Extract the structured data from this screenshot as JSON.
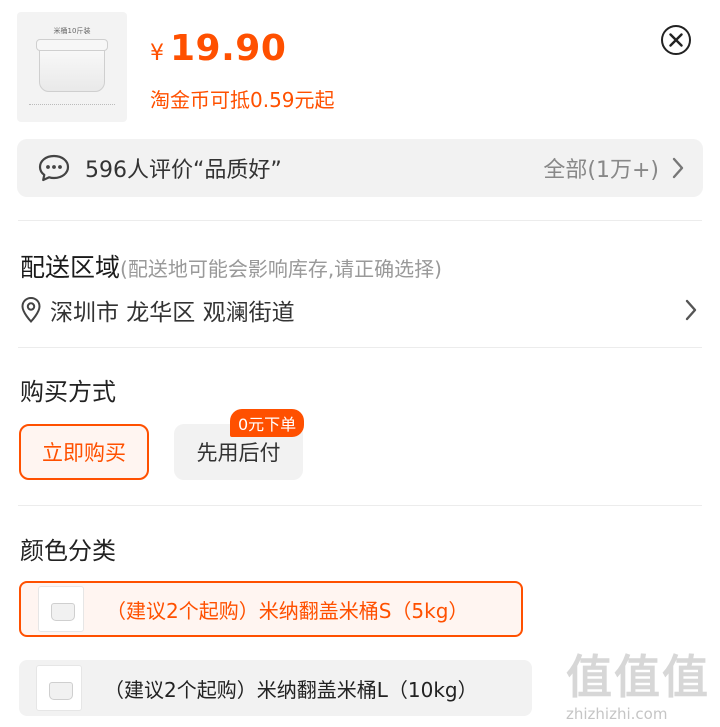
{
  "product": {
    "thumb_caption": "米桶10斤装",
    "currency": "¥",
    "price": "19.90",
    "coin_note": "淘金币可抵0.59元起"
  },
  "reviews": {
    "text": "596人评价“品质好”",
    "all_label": "全部(1万+)"
  },
  "delivery": {
    "title": "配送区域",
    "note": "(配送地可能会影响库存,请正确选择)",
    "address": "深圳市 龙华区 观澜街道"
  },
  "purchase": {
    "title": "购买方式",
    "options": [
      "立即购买",
      "先用后付"
    ],
    "badge": "0元下单",
    "selected": "立即购买"
  },
  "color": {
    "title": "颜色分类",
    "options": [
      {
        "label": "（建议2个起购）米纳翻盖米桶S（5kg）",
        "selected": true
      },
      {
        "label": "（建议2个起购）米纳翻盖米桶L（10kg）",
        "selected": false
      }
    ]
  },
  "watermark": {
    "logo": "值值值",
    "url": "zhizhizhi.com"
  },
  "colors": {
    "accent": "#ff5000",
    "panel_bg": "#f2f2f2",
    "muted_text": "#999999"
  },
  "icons": [
    "close-icon",
    "chat-bubble-icon",
    "chevron-right-icon",
    "location-pin-icon"
  ]
}
